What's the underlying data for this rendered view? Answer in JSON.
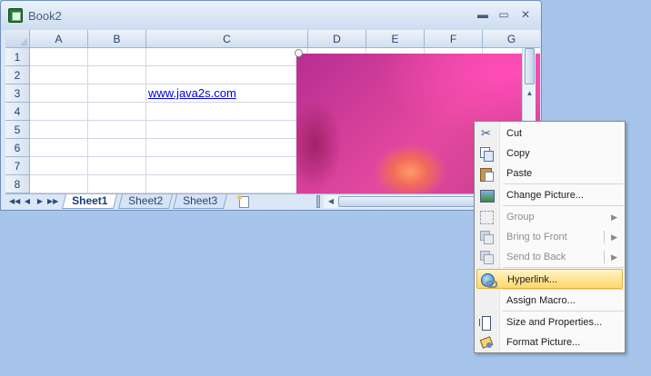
{
  "window": {
    "title": "Book2",
    "minimize": "▬",
    "restore": "▭",
    "close": "✕"
  },
  "grid": {
    "columns": [
      "A",
      "B",
      "C",
      "D",
      "E",
      "F",
      "G"
    ],
    "rows": [
      "1",
      "2",
      "3",
      "4",
      "5",
      "6",
      "7",
      "8"
    ],
    "cell_c3": "www.java2s.com"
  },
  "sheet_nav": [
    "◀◀",
    "◀",
    "▶",
    "▶▶"
  ],
  "sheet_tabs": [
    "Sheet1",
    "Sheet2",
    "Sheet3"
  ],
  "active_sheet": "Sheet1",
  "context_menu": {
    "items": [
      {
        "label": "Cut",
        "icon": "cut-icon",
        "enabled": true
      },
      {
        "label": "Copy",
        "icon": "copy-icon",
        "enabled": true
      },
      {
        "label": "Paste",
        "icon": "paste-icon",
        "enabled": true
      },
      {
        "label": "Change Picture...",
        "icon": "change-picture-icon",
        "enabled": true
      },
      {
        "label": "Group",
        "icon": "group-icon",
        "enabled": false,
        "submenu": true
      },
      {
        "label": "Bring to Front",
        "icon": "bring-to-front-icon",
        "enabled": false,
        "submenu": true
      },
      {
        "label": "Send to Back",
        "icon": "send-to-back-icon",
        "enabled": false,
        "submenu": true
      },
      {
        "label": "Hyperlink...",
        "icon": "hyperlink-icon",
        "enabled": true,
        "highlighted": true
      },
      {
        "label": "Assign Macro...",
        "icon": "",
        "enabled": true
      },
      {
        "label": "Size and Properties...",
        "icon": "size-properties-icon",
        "enabled": true
      },
      {
        "label": "Format Picture...",
        "icon": "format-picture-icon",
        "enabled": true
      }
    ],
    "submenu_arrow": "▶"
  },
  "colors": {
    "desktop": "#a7c4ea",
    "highlight": "#ffd76c",
    "link": "#0000ee"
  }
}
